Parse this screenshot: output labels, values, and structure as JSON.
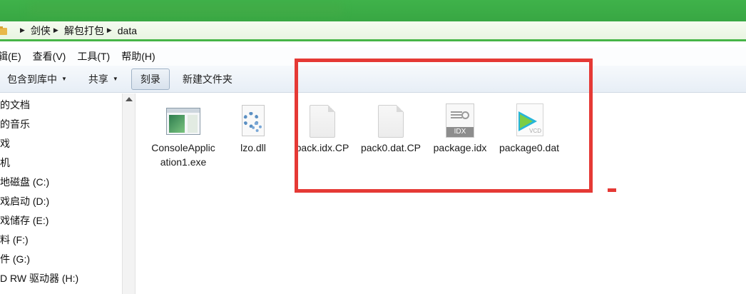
{
  "breadcrumb": [
    "剑侠",
    "解包打包",
    "data"
  ],
  "menu": [
    "辑(E)",
    "查看(V)",
    "工具(T)",
    "帮助(H)"
  ],
  "toolbar": {
    "include_library": "包含到库中",
    "share": "共享",
    "burn": "刻录",
    "new_folder": "新建文件夹"
  },
  "nav": [
    "的文档",
    "的音乐",
    "戏",
    "机",
    "地磁盘 (C:)",
    "戏启动 (D:)",
    "戏储存 (E:)",
    "料 (F:)",
    "件 (G:)",
    "D RW 驱动器 (H:)"
  ],
  "files": [
    {
      "name": "ConsoleApplication1.exe",
      "icon": "exe-icon"
    },
    {
      "name": "lzo.dll",
      "icon": "dll-gear-icon"
    },
    {
      "name": "pack.idx.CP",
      "icon": "blank-file-icon"
    },
    {
      "name": "pack0.dat.CP",
      "icon": "blank-file-icon"
    },
    {
      "name": "package.idx",
      "icon": "idx-file-icon"
    },
    {
      "name": "package0.dat",
      "icon": "vcd-file-icon"
    }
  ],
  "idx_badge": "IDX",
  "vcd_badge": "VCD",
  "colors": {
    "highlight": "#e53935",
    "title_green": "#3fb24a"
  }
}
